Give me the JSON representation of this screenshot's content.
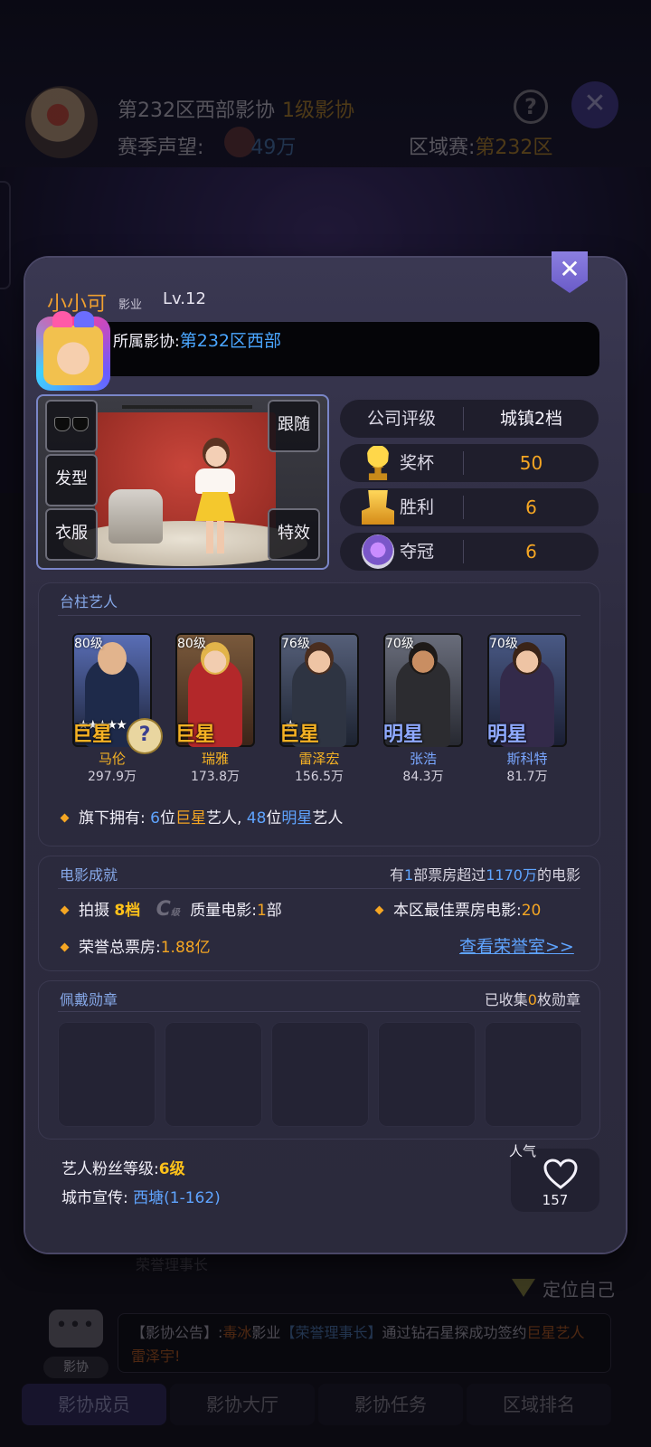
{
  "background": {
    "guild_title": "第232区西部影协",
    "guild_level": "1级影协",
    "season_fame_label": "赛季声望:",
    "season_fame_value": "49万",
    "region_label": "区域赛:",
    "region_value": "第232区",
    "member_rank_text": "荣誉理事长",
    "locate_self": "定位自己",
    "notice": {
      "prefix": "【影协公告】:",
      "actor": "毒冰",
      "company": "影业",
      "role": "【荣誉理事长】",
      "middle": "通过钻石星探成功签约",
      "highlight": "巨星艺人雷泽宇!"
    },
    "chat_label": "影协",
    "tabs": [
      "影协成员",
      "影协大厅",
      "影协任务",
      "区域排名"
    ]
  },
  "profile": {
    "name": "小小可",
    "company_tag": "影业",
    "level": "Lv.12",
    "guild_label": "所属影协:",
    "guild_value": "第232区西部"
  },
  "stage": {
    "slots": {
      "hair": "发型",
      "clothes": "衣服",
      "follow": "跟随",
      "effects": "特效"
    }
  },
  "stats": {
    "rating_label": "公司评级",
    "rating_value": "城镇2档",
    "trophy_label": "奖杯",
    "trophy_value": "50",
    "victory_label": "胜利",
    "victory_value": "6",
    "champion_label": "夺冠",
    "champion_value": "6"
  },
  "artists_section": {
    "title": "台柱艺人",
    "artists": [
      {
        "level": "80级",
        "tier": "巨星",
        "name": "马伦",
        "fans": "297.9万",
        "stars": "★★★★★"
      },
      {
        "level": "80级",
        "tier": "巨星",
        "name": "瑞雅",
        "fans": "173.8万",
        "stars": ""
      },
      {
        "level": "76级",
        "tier": "巨星",
        "name": "雷泽宏",
        "fans": "156.5万",
        "stars": "★"
      },
      {
        "level": "70级",
        "tier": "明星",
        "name": "张浩",
        "fans": "84.3万",
        "stars": ""
      },
      {
        "level": "70级",
        "tier": "明星",
        "name": "斯科特",
        "fans": "81.7万",
        "stars": ""
      }
    ],
    "owned_prefix": "旗下拥有:",
    "superstar_count": "6",
    "superstar_unit": "位",
    "superstar_word": "巨星",
    "artist_word": "艺人,",
    "star_count": "48",
    "star_unit": "位",
    "star_word": "明星",
    "artist_word2": "艺人"
  },
  "film_section": {
    "title": "电影成就",
    "note_prefix": "有",
    "note_count": "1",
    "note_middle": "部票房超过",
    "note_amount": "1170万",
    "note_suffix": "的电影",
    "shoot_label": "拍摄",
    "shoot_value": "8档",
    "rank_letter": "C",
    "rank_suffix": "级",
    "quality_label": "质量电影:",
    "quality_count": "1",
    "quality_unit": "部",
    "best_label": "本区最佳票房电影:",
    "best_value": "20",
    "honor_label": "荣誉总票房:",
    "honor_value": "1.88亿",
    "honor_link": "查看荣誉室>>"
  },
  "medals_section": {
    "title": "佩戴勋章",
    "collected_prefix": "已收集",
    "collected_count": "0",
    "collected_suffix": "枚勋章"
  },
  "footer": {
    "fan_level_label": "艺人粉丝等级:",
    "fan_level_value": "6级",
    "city_label": "城市宣传:",
    "city_value": "西塘(1-162)",
    "popularity_label": "人气",
    "popularity_value": "157"
  },
  "colors": {
    "accent_orange": "#f5a623",
    "accent_blue": "#5fa4ff",
    "panel_bg": "#2d2b3f"
  }
}
